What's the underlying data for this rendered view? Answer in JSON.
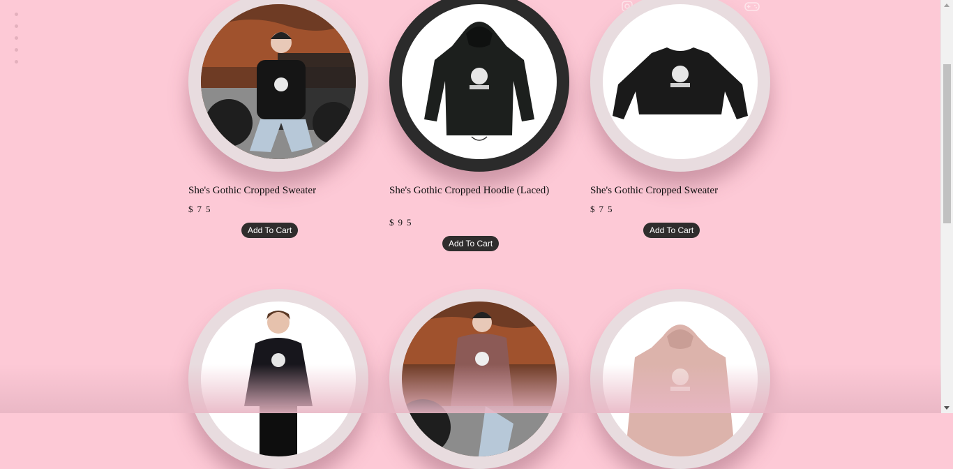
{
  "products": [
    {
      "title": "She's Gothic Cropped Sweater",
      "price": "$75",
      "button": "Add To Cart"
    },
    {
      "title": "She's Gothic Cropped Hoodie (Laced)",
      "price": "$95",
      "button": "Add To Cart"
    },
    {
      "title": "She's Gothic Cropped Sweater",
      "price": "$75",
      "button": "Add To Cart"
    },
    {
      "title": "",
      "price": "",
      "button": ""
    },
    {
      "title": "",
      "price": "",
      "button": ""
    },
    {
      "title": "",
      "price": "",
      "button": ""
    }
  ],
  "top_icons": [
    "instagram-icon",
    "user-icon",
    "cart-icon",
    "tiktok-icon",
    "gamepad-icon"
  ],
  "colors": {
    "background": "#fdc9d6",
    "button": "#2f2d2d",
    "ring": "#e8dcdf",
    "ring_dark": "#2b2b2b"
  }
}
